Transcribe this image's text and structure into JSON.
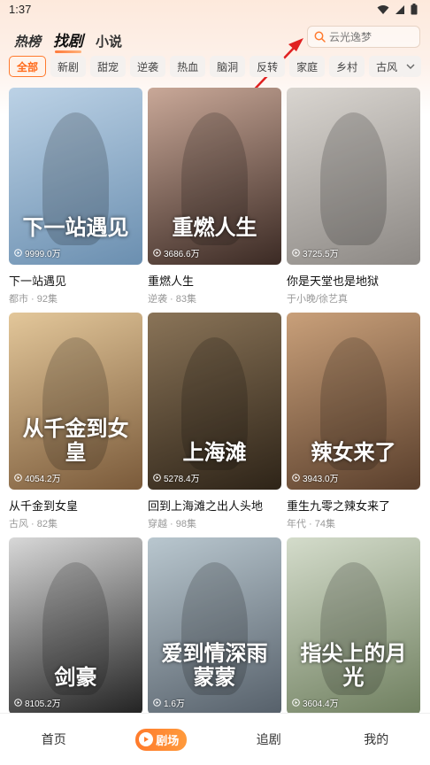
{
  "status": {
    "time": "1:37"
  },
  "tabs": [
    {
      "label": "热榜"
    },
    {
      "label": "找剧"
    },
    {
      "label": "小说"
    }
  ],
  "search": {
    "placeholder": "云光逸梦"
  },
  "filters": [
    "全部",
    "新剧",
    "甜宠",
    "逆袭",
    "热血",
    "脑洞",
    "反转",
    "家庭",
    "乡村",
    "古风"
  ],
  "cards": [
    {
      "title": "下一站遇见",
      "meta": "都市 · 92集",
      "views": "9999.0万",
      "poster_text": "下一站遇见",
      "colors": [
        "#bcd2e6",
        "#6b8fb0"
      ]
    },
    {
      "title": "重燃人生",
      "meta": "逆袭 · 83集",
      "views": "3686.6万",
      "poster_text": "重燃人生",
      "colors": [
        "#c9a898",
        "#3b2a24"
      ]
    },
    {
      "title": "你是天堂也是地狱",
      "meta": "于小晚/徐艺真",
      "views": "3725.5万",
      "poster_text": "",
      "colors": [
        "#d9d5d0",
        "#8c8884"
      ]
    },
    {
      "title": "从千金到女皇",
      "meta": "古风 · 82集",
      "views": "4054.2万",
      "poster_text": "从千金到女皇",
      "colors": [
        "#e3c79a",
        "#7a5a3a"
      ]
    },
    {
      "title": "回到上海滩之出人头地",
      "meta": "穿越 · 98集",
      "views": "5278.4万",
      "poster_text": "上海滩",
      "colors": [
        "#8a7458",
        "#2e2418"
      ]
    },
    {
      "title": "重生九零之辣女来了",
      "meta": "年代 · 74集",
      "views": "3943.0万",
      "poster_text": "辣女来了",
      "colors": [
        "#c9a07a",
        "#5a3f2c"
      ]
    },
    {
      "title": "",
      "meta": "",
      "views": "8105.2万",
      "poster_text": "剑豪",
      "colors": [
        "#d8d8d8",
        "#222222"
      ]
    },
    {
      "title": "",
      "meta": "",
      "views": "1.6万",
      "poster_text": "爱到情深雨蒙蒙",
      "colors": [
        "#b9c7cf",
        "#56606a"
      ]
    },
    {
      "title": "",
      "meta": "",
      "views": "3604.4万",
      "poster_text": "指尖上的月光",
      "colors": [
        "#d4dccb",
        "#6f7f5f"
      ]
    }
  ],
  "bottom_nav": [
    {
      "label": "首页"
    },
    {
      "label": "剧场"
    },
    {
      "label": "追剧"
    },
    {
      "label": "我的"
    }
  ],
  "accent_color": "#ff6a1a"
}
